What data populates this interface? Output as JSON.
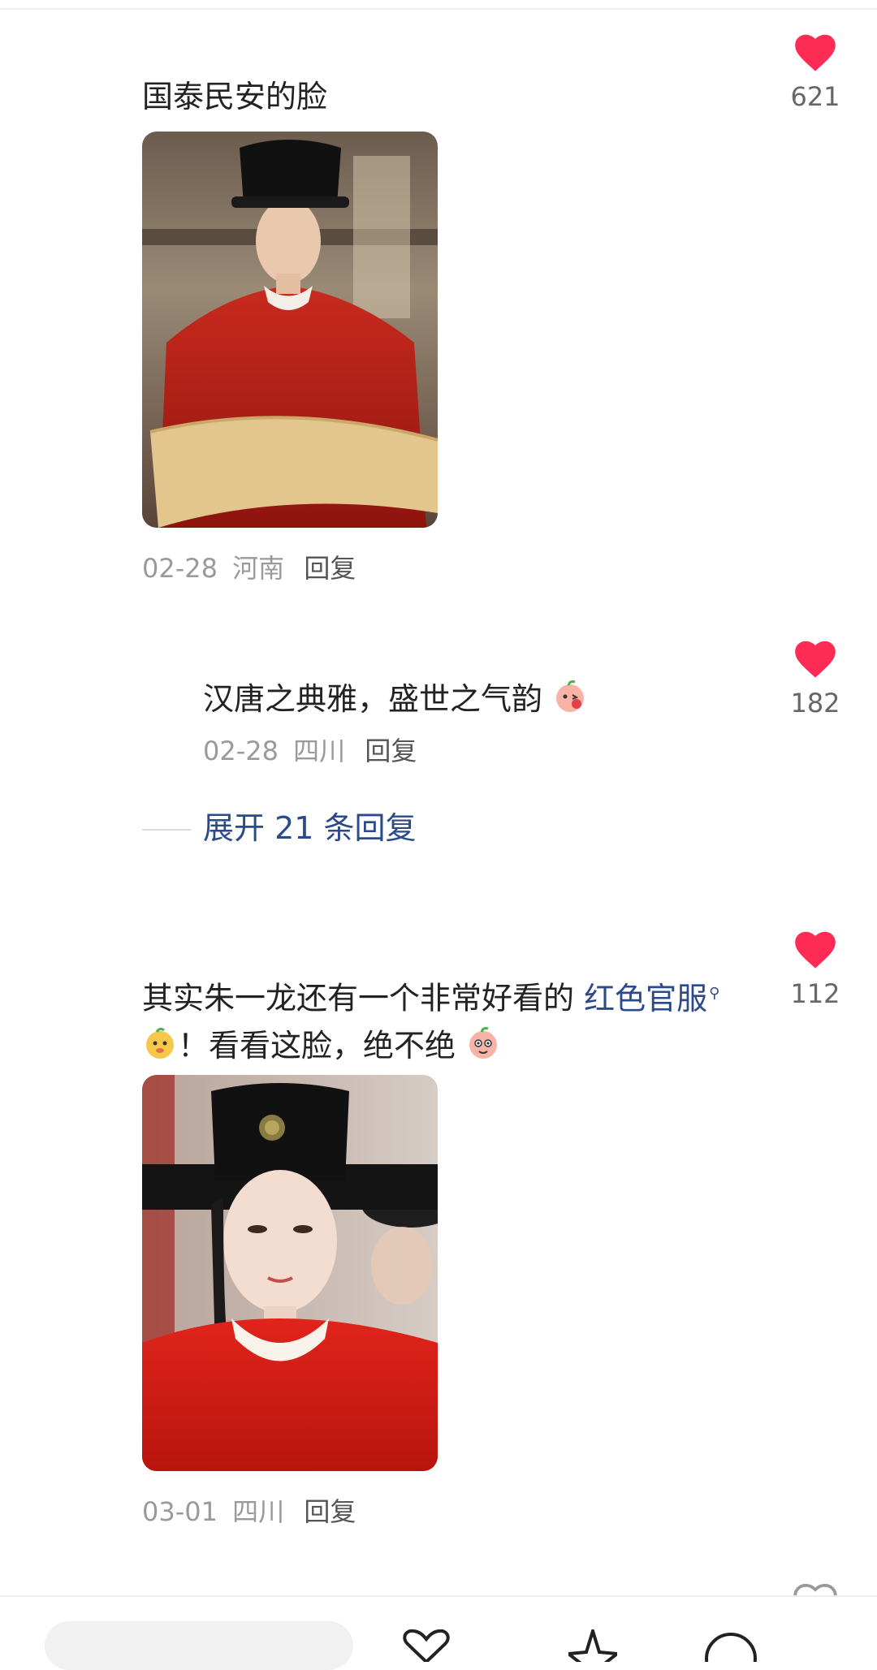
{
  "comments": [
    {
      "text": "国泰民安的脸",
      "date": "02-28",
      "region": "河南",
      "reply_label": "回复",
      "likes": "621"
    },
    {
      "text": "汉唐之典雅，盛世之气韵",
      "date": "02-28",
      "region": "四川",
      "reply_label": "回复",
      "likes": "182"
    },
    {
      "text_part1": "其实朱一龙还有一个非常好看的",
      "link": "红色官服",
      "text_part2": "！看看这脸，绝不绝",
      "date": "03-01",
      "region": "四川",
      "reply_label": "回复",
      "likes": "112"
    }
  ],
  "expand_replies": "展开 21 条回复",
  "icons": {
    "like": "heart-icon",
    "search_hint": "search-icon",
    "emoji": "emoji-icon"
  },
  "colors": {
    "like": "#fe2c55",
    "link": "#2b4a8a",
    "meta": "#9a9a9a"
  }
}
